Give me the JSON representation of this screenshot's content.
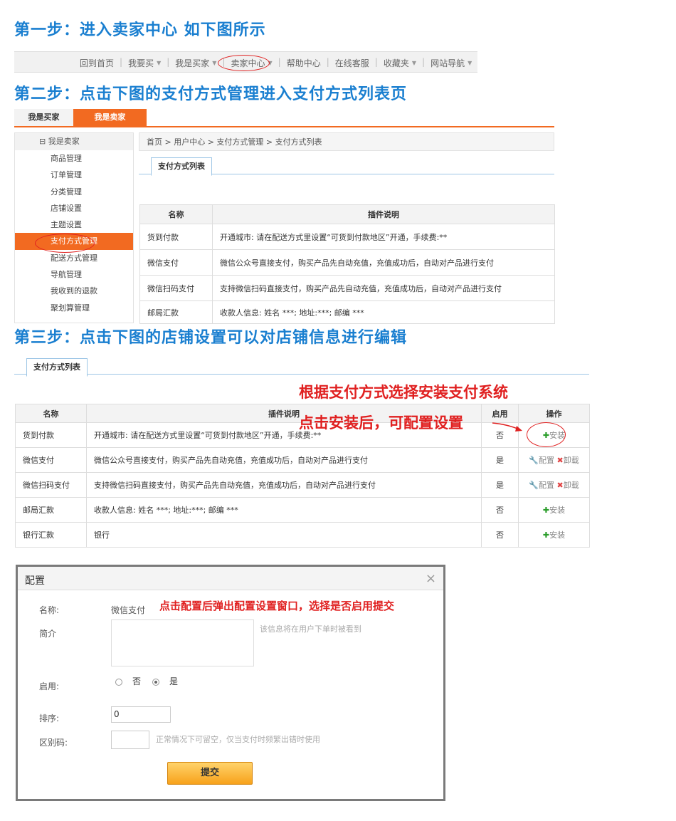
{
  "steps": {
    "step1": "第一步：进入卖家中心 如下图所示",
    "step2": "第二步：点击下图的支付方式管理进入支付方式列表页",
    "step3": "第三步：点击下图的店铺设置可以对店铺信息进行编辑"
  },
  "topnav": {
    "items": [
      "回到首页",
      "我要买",
      "我是买家",
      "卖家中心",
      "帮助中心",
      "在线客服",
      "收藏夹",
      "网站导航"
    ]
  },
  "step2": {
    "tabs": [
      "我是买家",
      "我是卖家"
    ],
    "sidebar_head": "我是卖家",
    "sidebar_items": [
      "商品管理",
      "订单管理",
      "分类管理",
      "店铺设置",
      "主题设置",
      "支付方式管理",
      "配送方式管理",
      "导航管理",
      "我收到的退款",
      "聚划算管理"
    ],
    "breadcrumb": "首页 > 用户中心 > 支付方式管理 > 支付方式列表",
    "subtab": "支付方式列表",
    "headers": [
      "名称",
      "插件说明"
    ],
    "rows": [
      [
        "货到付款",
        "开通城市: 请在配送方式里设置“可货到付款地区”开通，手续费:**"
      ],
      [
        "微信支付",
        "微信公众号直接支付，购买产品先自动充值，充值成功后，自动对产品进行支付"
      ],
      [
        "微信扫码支付",
        "支持微信扫码直接支付，购买产品先自动充值，充值成功后，自动对产品进行支付"
      ],
      [
        "邮局汇款",
        "收款人信息: 姓名 ***; 地址:***; 邮编 ***"
      ]
    ]
  },
  "step3": {
    "subtab": "支付方式列表",
    "note1": "根据支付方式选择安装支付系统",
    "note2": "点击安装后，可配置设置",
    "headers": [
      "名称",
      "插件说明",
      "启用",
      "操作"
    ],
    "rows": [
      {
        "name": "货到付款",
        "desc": "开通城市: 请在配送方式里设置“可货到付款地区”开通，手续费:**",
        "enabled": "否",
        "op1": "安装",
        "op2": ""
      },
      {
        "name": "微信支付",
        "desc": "微信公众号直接支付，购买产品先自动充值，充值成功后，自动对产品进行支付",
        "enabled": "是",
        "op1": "配置",
        "op2": "卸载"
      },
      {
        "name": "微信扫码支付",
        "desc": "支持微信扫码直接支付，购买产品先自动充值，充值成功后，自动对产品进行支付",
        "enabled": "是",
        "op1": "配置",
        "op2": "卸载"
      },
      {
        "name": "邮局汇款",
        "desc": "收款人信息: 姓名 ***; 地址:***; 邮编 ***",
        "enabled": "否",
        "op1": "安装",
        "op2": ""
      },
      {
        "name": "银行汇款",
        "desc": "银行",
        "enabled": "否",
        "op1": "安装",
        "op2": ""
      }
    ]
  },
  "dialog": {
    "title": "配置",
    "close": "×",
    "note": "点击配置后弹出配置设置窗口，选择是否启用提交",
    "name_label": "名称:",
    "name_value": "微信支付",
    "intro_label": "简介",
    "intro_hint": "该信息将在用户下单时被看到",
    "enable_label": "启用:",
    "enable_no": "否",
    "enable_yes": "是",
    "enable_value": "是",
    "sort_label": "排序:",
    "sort_value": "0",
    "code_label": "区别码:",
    "code_hint": "正常情况下可留空，仅当支付时频繁出错时使用",
    "submit": "提交"
  }
}
